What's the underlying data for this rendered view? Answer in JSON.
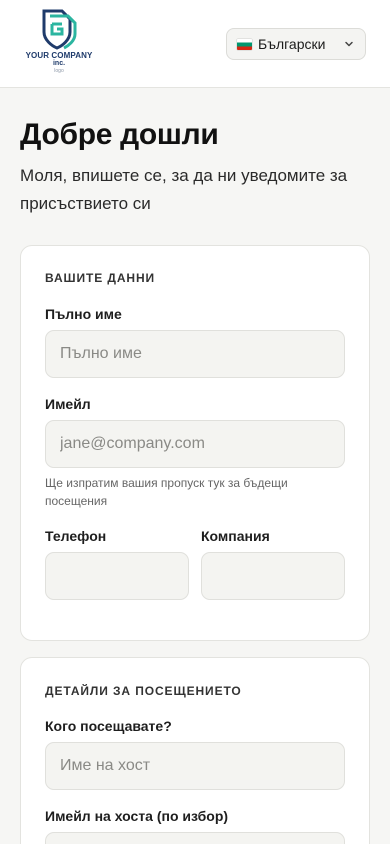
{
  "brand": {
    "logo_line1": "YOUR COMPANY",
    "logo_line2": "inc.",
    "logo_line3": "logo"
  },
  "language": {
    "selected": "Български",
    "flag_icon": "bulgaria-flag-icon"
  },
  "welcome": {
    "title": "Добре дошли",
    "subtitle": "Моля, впишете се, за да ни уведомите за присъствието си"
  },
  "your_details": {
    "section_title": "ВАШИТЕ ДАННИ",
    "full_name_label": "Пълно име",
    "full_name_placeholder": "Пълно име",
    "email_label": "Имейл",
    "email_placeholder": "jane@company.com",
    "email_help": "Ще изпратим вашия пропуск тук за бъдещи посещения",
    "phone_label": "Телефон",
    "company_label": "Компания"
  },
  "visit_details": {
    "section_title": "ДЕТАЙЛИ ЗА ПОСЕЩЕНИЕТО",
    "host_label": "Кого посещавате?",
    "host_placeholder": "Име на хост",
    "host_email_label": "Имейл на хоста (по избор)"
  },
  "colors": {
    "page_bg": "#f6f6f4",
    "card_bg": "#ffffff",
    "input_bg": "#f4f4f1",
    "logo_primary": "#1f3b6b",
    "logo_accent": "#2bb5a0"
  }
}
